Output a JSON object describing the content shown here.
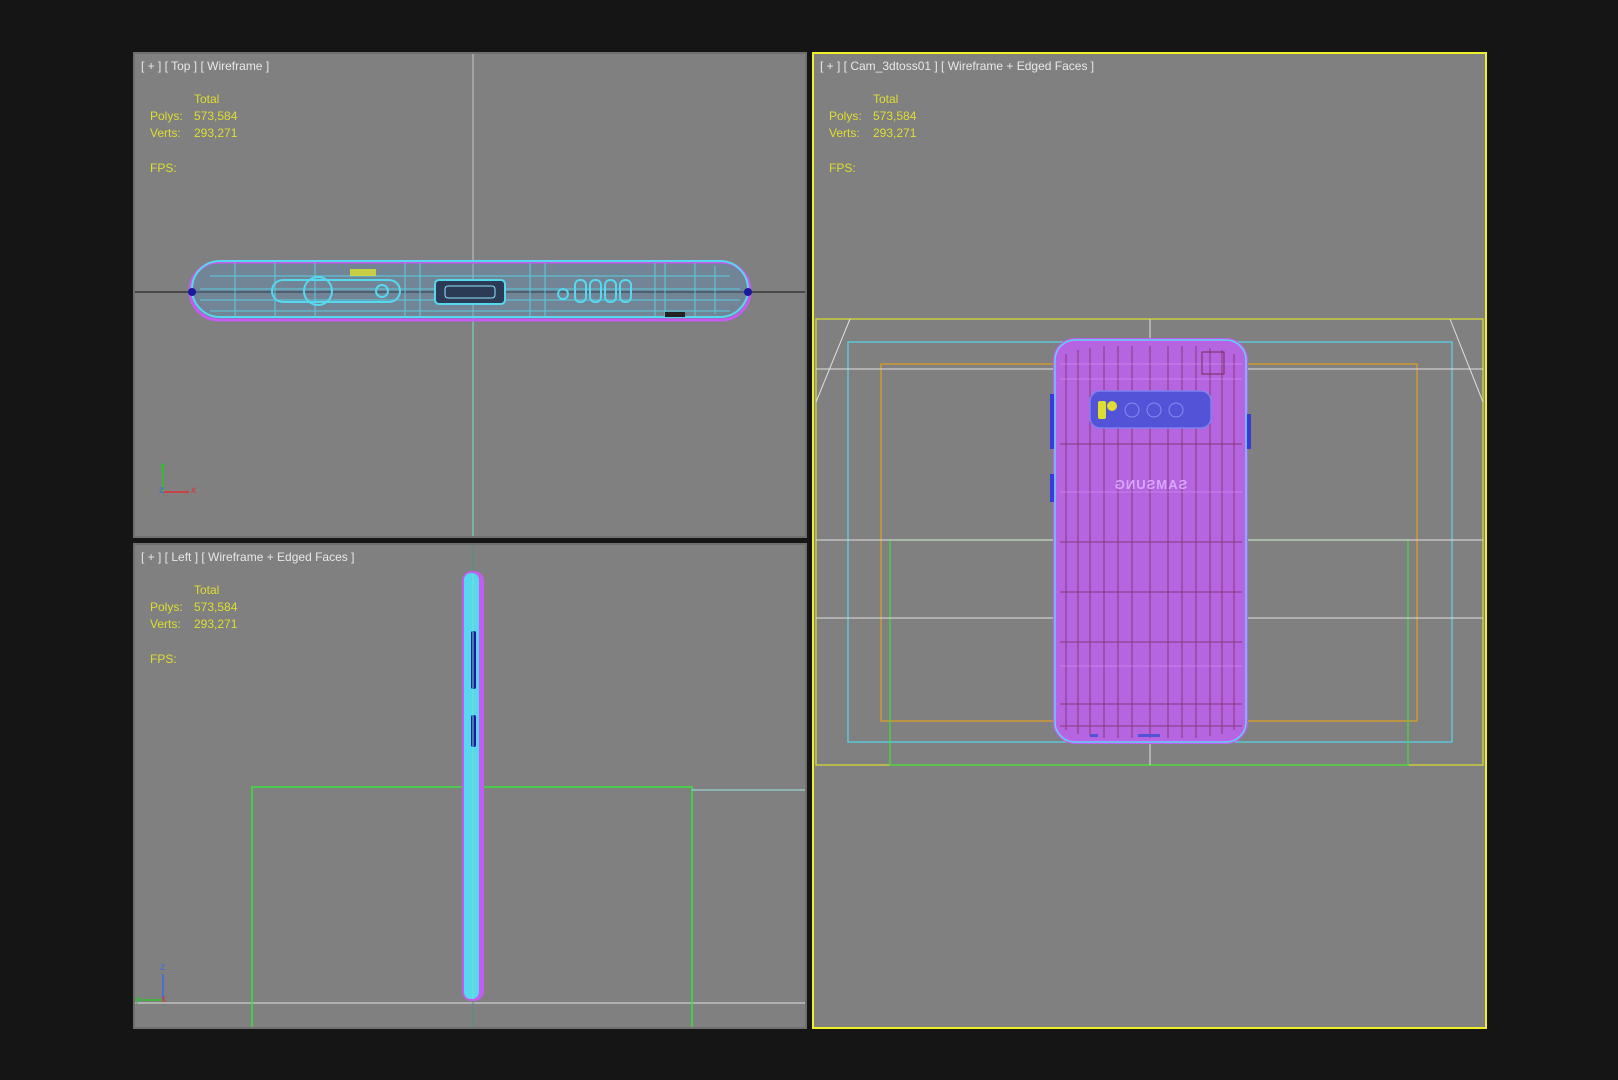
{
  "viewports": {
    "top": {
      "label": "[ + ] [ Top ] [ Wireframe ]"
    },
    "left": {
      "label": "[ + ] [ Left ] [ Wireframe + Edged Faces ]"
    },
    "cam": {
      "label": "[ + ] [ Cam_3dtoss01 ] [ Wireframe + Edged Faces ]",
      "active": true
    }
  },
  "stats": {
    "total_label": "Total",
    "polys_label": "Polys:",
    "polys_value": "573,584",
    "verts_label": "Verts:",
    "verts_value": "293,271",
    "fps_label": "FPS:"
  },
  "axes": {
    "top": {
      "vertical": "y",
      "horizontal": "x",
      "depth": "z"
    },
    "left": {
      "vertical": "z",
      "horizontal": "y",
      "depth": "x"
    }
  },
  "model_text": "SAMSUNG",
  "colors": {
    "viewport_bg": "#808080",
    "active_border": "#f0f02a",
    "stats_text": "#dede32",
    "wire_cyan": "#56d8ef",
    "wire_magenta": "#c55cf0",
    "wire_blue": "#4a4ae0"
  }
}
